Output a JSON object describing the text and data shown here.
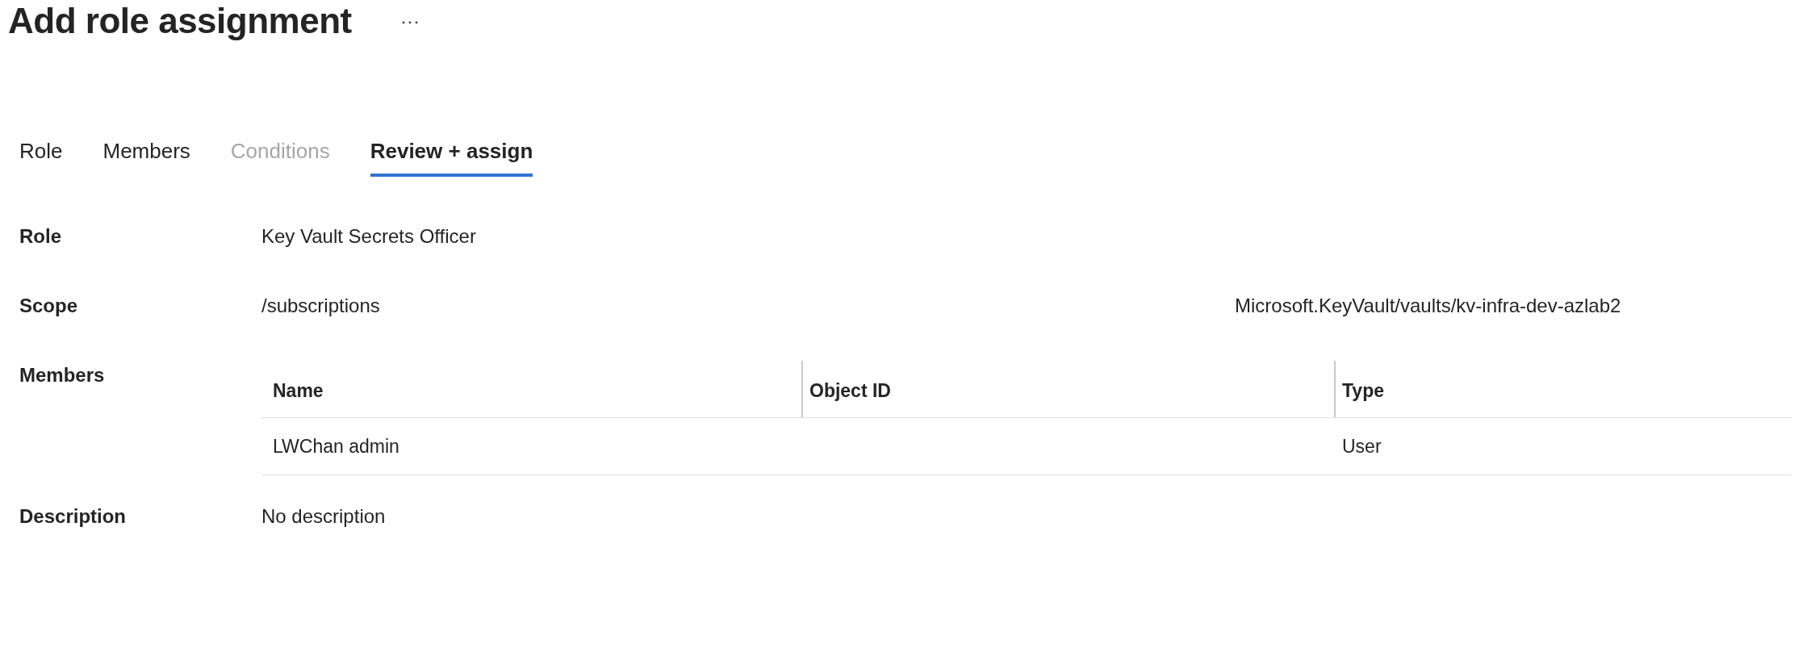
{
  "title": "Add role assignment",
  "tabs": [
    {
      "label": "Role",
      "selected": false,
      "disabled": false
    },
    {
      "label": "Members",
      "selected": false,
      "disabled": false
    },
    {
      "label": "Conditions",
      "selected": false,
      "disabled": true
    },
    {
      "label": "Review + assign",
      "selected": true,
      "disabled": false
    }
  ],
  "details": [
    {
      "kind": "text",
      "label": "Role",
      "value": "Key Vault Secrets Officer"
    },
    {
      "kind": "scope",
      "label": "Scope",
      "value_start": "/subscriptions",
      "value_end": "Microsoft.KeyVault/vaults/kv-infra-dev-azlab2"
    },
    {
      "kind": "table",
      "label": "Members",
      "table": {
        "columns": [
          "Name",
          "Object ID",
          "Type"
        ],
        "rows": [
          {
            "name": "LWChan admin",
            "type": "User"
          }
        ]
      }
    },
    {
      "kind": "text",
      "label": "Description",
      "value": "No description"
    }
  ]
}
